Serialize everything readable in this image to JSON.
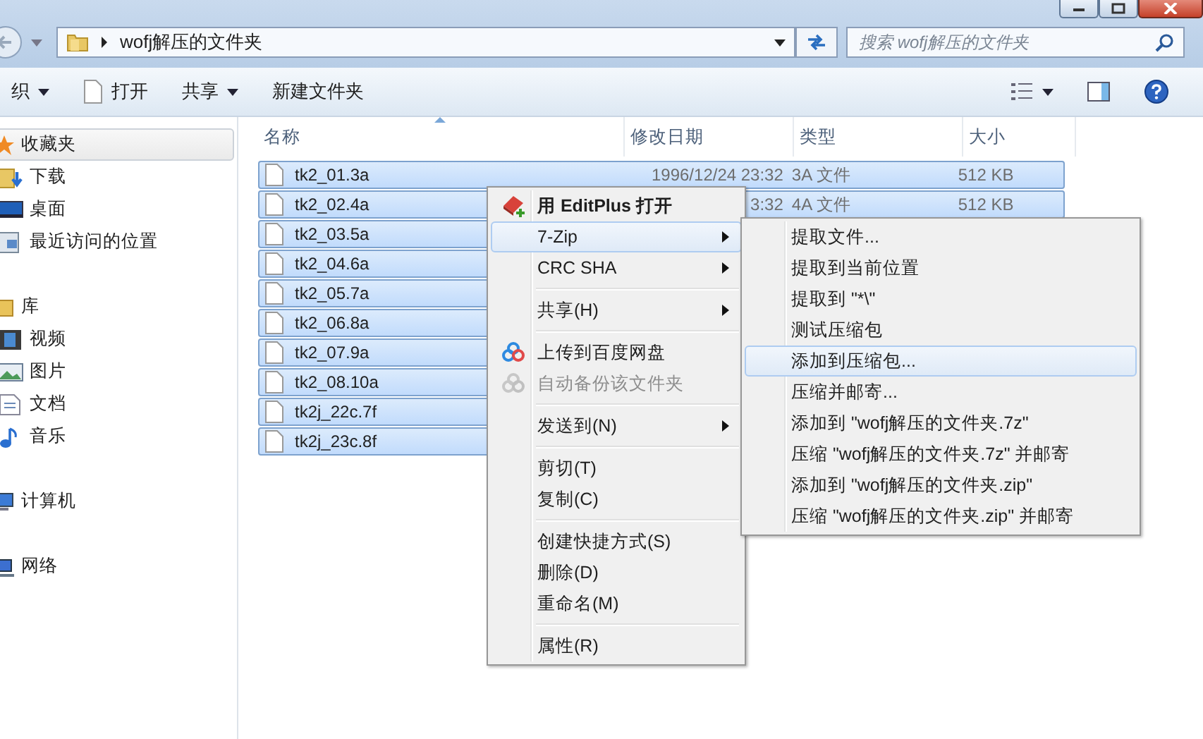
{
  "address": {
    "path": "wofj解压的文件夹"
  },
  "search": {
    "placeholder": "搜索 wofj解压的文件夹"
  },
  "toolbar": [
    {
      "label": "织",
      "dropdown": true
    },
    {
      "label": "打开",
      "dropdown": false
    },
    {
      "label": "共享",
      "dropdown": true
    },
    {
      "label": "新建文件夹",
      "dropdown": false
    }
  ],
  "sidebar": {
    "groups": [
      {
        "label": "收藏夹",
        "selected": true,
        "children": [
          {
            "label": "下载",
            "selected": false
          },
          {
            "label": "桌面",
            "selected": false
          },
          {
            "label": "最近访问的位置",
            "selected": false
          }
        ]
      },
      {
        "label": "库",
        "selected": false,
        "children": [
          {
            "label": "视频",
            "selected": false
          },
          {
            "label": "图片",
            "selected": false
          },
          {
            "label": "文档",
            "selected": false
          },
          {
            "label": "音乐",
            "selected": false
          }
        ]
      },
      {
        "label": "计算机",
        "selected": false
      },
      {
        "label": "网络",
        "selected": false
      }
    ]
  },
  "table": {
    "columns": [
      "名称",
      "修改日期",
      "类型",
      "大小"
    ],
    "rows": [
      {
        "name": "tk2_01.3a",
        "date": "1996/12/24 23:32",
        "type": "3A 文件",
        "size": "512 KB",
        "selected": true
      },
      {
        "name": "tk2_02.4a",
        "date": "3:32",
        "type": "4A 文件",
        "size": "512 KB",
        "selected": true
      },
      {
        "name": "tk2_03.5a",
        "selected": true
      },
      {
        "name": "tk2_04.6a",
        "selected": true
      },
      {
        "name": "tk2_05.7a",
        "selected": true
      },
      {
        "name": "tk2_06.8a",
        "selected": true
      },
      {
        "name": "tk2_07.9a",
        "selected": true
      },
      {
        "name": "tk2_08.10a",
        "selected": true
      },
      {
        "name": "tk2j_22c.7f",
        "selected": true
      },
      {
        "name": "tk2j_23c.8f",
        "selected": true
      }
    ]
  },
  "context_menu": {
    "items": [
      {
        "kind": "item",
        "label": "用 EditPlus 打开",
        "bold": true,
        "disabled": false,
        "submenu": false,
        "selected": false
      },
      {
        "kind": "item",
        "label": "7-Zip",
        "bold": false,
        "disabled": false,
        "submenu": true,
        "selected": true
      },
      {
        "kind": "item",
        "label": "CRC SHA",
        "bold": false,
        "disabled": false,
        "submenu": true,
        "selected": false
      },
      {
        "kind": "separator"
      },
      {
        "kind": "item",
        "label": "共享(H)",
        "bold": false,
        "disabled": false,
        "submenu": true,
        "selected": false
      },
      {
        "kind": "separator"
      },
      {
        "kind": "item",
        "label": "上传到百度网盘",
        "bold": false,
        "disabled": false,
        "submenu": false,
        "selected": false
      },
      {
        "kind": "item",
        "label": "自动备份该文件夹",
        "bold": false,
        "disabled": true,
        "submenu": false,
        "selected": false
      },
      {
        "kind": "separator"
      },
      {
        "kind": "item",
        "label": "发送到(N)",
        "bold": false,
        "disabled": false,
        "submenu": true,
        "selected": false
      },
      {
        "kind": "separator"
      },
      {
        "kind": "item",
        "label": "剪切(T)",
        "bold": false,
        "disabled": false,
        "submenu": false,
        "selected": false
      },
      {
        "kind": "item",
        "label": "复制(C)",
        "bold": false,
        "disabled": false,
        "submenu": false,
        "selected": false
      },
      {
        "kind": "separator"
      },
      {
        "kind": "item",
        "label": "创建快捷方式(S)",
        "bold": false,
        "disabled": false,
        "submenu": false,
        "selected": false
      },
      {
        "kind": "item",
        "label": "删除(D)",
        "bold": false,
        "disabled": false,
        "submenu": false,
        "selected": false
      },
      {
        "kind": "item",
        "label": "重命名(M)",
        "bold": false,
        "disabled": false,
        "submenu": false,
        "selected": false
      },
      {
        "kind": "separator"
      },
      {
        "kind": "item",
        "label": "属性(R)",
        "bold": false,
        "disabled": false,
        "submenu": false,
        "selected": false
      }
    ]
  },
  "submenu": {
    "items": [
      {
        "label": "提取文件...",
        "selected": false
      },
      {
        "label": "提取到当前位置",
        "selected": false
      },
      {
        "label": "提取到 \"*\\\"",
        "selected": false
      },
      {
        "label": "测试压缩包",
        "selected": false
      },
      {
        "label": "添加到压缩包...",
        "selected": true
      },
      {
        "label": "压缩并邮寄...",
        "selected": false
      },
      {
        "label": "添加到 \"wofj解压的文件夹.7z\"",
        "selected": false
      },
      {
        "label": "压缩 \"wofj解压的文件夹.7z\" 并邮寄",
        "selected": false
      },
      {
        "label": "添加到 \"wofj解压的文件夹.zip\"",
        "selected": false
      },
      {
        "label": "压缩 \"wofj解压的文件夹.zip\" 并邮寄",
        "selected": false
      }
    ]
  }
}
